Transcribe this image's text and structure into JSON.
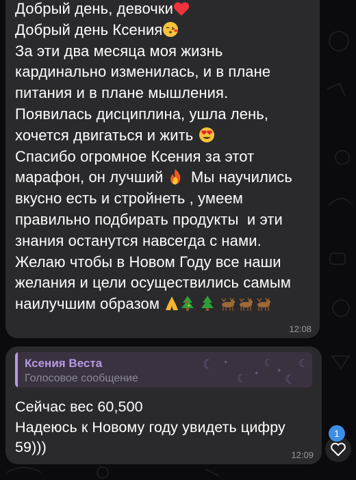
{
  "messages": [
    {
      "lines": [
        "Добрый день, девочки",
        "Добрый день Ксения",
        "За эти два месяца моя жизнь",
        "кардинально изменилась, и в плане",
        "питания и в плане мышления.",
        "Появилась дисциплина, ушла лень,",
        "хочется двигаться и жить",
        "Спасибо огромное Ксения за этот",
        "марафон, он лучший",
        "Мы научились",
        "вкусно есть и стройнеть , умеем",
        "правильно подбирать продукты  и эти",
        "знания останутся навсегда с нами.",
        "Желаю чтобы в Новом Году все наши",
        "желания и цели осуществились самым",
        "наилучшим образом"
      ],
      "time": "12:08"
    },
    {
      "reply": {
        "author": "Ксения Веста",
        "preview": "Голосовое сообщение"
      },
      "lines": [
        "Сейчас вес 60,500",
        "Надеюсь к Новому году увидеть цифру",
        "59)))"
      ],
      "time": "12:09"
    }
  ],
  "floating": {
    "unread_badge": "1"
  },
  "icons": {
    "emoji_heart": "red-heart-icon",
    "emoji_kiss": "face-blowing-kiss-icon",
    "emoji_heart_eyes": "heart-eyes-icon",
    "emoji_fire": "fire-icon",
    "emoji_pray": "folded-hands-icon",
    "emoji_tree": "christmas-tree-icon",
    "emoji_deer": "deer-icon",
    "reaction": "heart-outline-icon"
  },
  "colors": {
    "background": "#0b0a0c",
    "bubble": "#2a2a2c",
    "text": "#ffffff",
    "time": "#9a999c",
    "reply_accent": "#b69be6",
    "badge": "#3d8ee6"
  }
}
